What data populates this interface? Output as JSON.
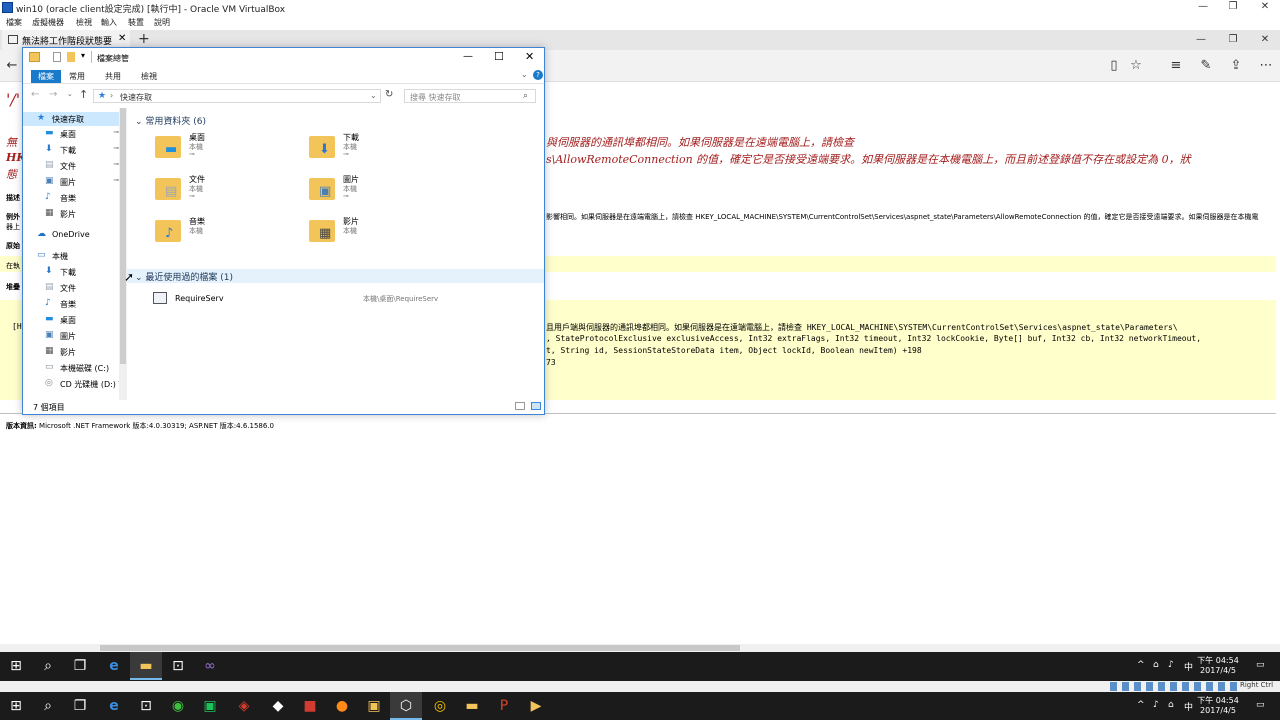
{
  "host": {
    "title": "win10 (oracle client設定完成) [執行中] - Oracle VM VirtualBox",
    "menu": [
      "檔案",
      "虛擬機器",
      "檢視",
      "輸入",
      "裝置",
      "說明"
    ],
    "status_right": "Right Ctrl"
  },
  "browser": {
    "tab_title": "無法將工作階段狀態要求",
    "new_tab": "+"
  },
  "page": {
    "title": "'/'",
    "err_line1_left": "無",
    "err_line1_right": "與伺服器的通訊埠都相同。如果伺服器是在遠端電腦上，請檢查",
    "err_line2_left": "HK",
    "err_line2_right": "s\\AllowRemoteConnection 的值，確定它是否接受遠端要求。如果伺服器是在本機電腦上，而且前述登錄值不存在或設定為 0，狀",
    "err_line3_left": "態",
    "label_desc": "描述",
    "label_exception": "例外",
    "exception_text": "影響相同。如果伺服器是在遠端電腦上，請檢查 HKEY_LOCAL_MACHINE\\SYSTEM\\CurrentControlSet\\Services\\aspnet_state\\Parameters\\AllowRemoteConnection 的值，確定它是否接受遠端要求。如果伺服器是在本機電",
    "exception_text2": "器上",
    "label_source": "原始",
    "source_note": "在執",
    "label_stack": "堆疊",
    "stack_line0": "[H",
    "stack_line1": "且用戶端與伺服器的通訊埠都相同。如果伺服器是在遠端電腦上，請檢查 HKEY_LOCAL_MACHINE\\SYSTEM\\CurrentControlSet\\Services\\aspnet_state\\Parameters\\",
    "stack_line2": ", StateProtocolExclusive exclusiveAccess, Int32 extraFlags, Int32 timeout, Int32 lockCookie, Byte[] buf, Int32 cb, Int32 networkTimeout,",
    "stack_line3": "t, String id, SessionStateStoreData item, Object lockId, Boolean newItem) +198",
    "stack_line4": "73",
    "version_label": "版本資訊:",
    "version_text": "Microsoft .NET Framework 版本:4.0.30319; ASP.NET 版本:4.6.1586.0"
  },
  "explorer": {
    "title": "檔案總管",
    "ribbon": {
      "file": "檔案",
      "tabs": [
        "常用",
        "共用",
        "檢視"
      ]
    },
    "address": "快速存取",
    "search_placeholder": "搜尋 快速存取",
    "tree": [
      {
        "label": "快速存取",
        "icon": "star-icon",
        "pinned": false,
        "color": "#2d7fd8"
      },
      {
        "label": "桌面",
        "icon": "desktop-icon",
        "pinned": true,
        "color": "#1f8fe0"
      },
      {
        "label": "下載",
        "icon": "download-icon",
        "pinned": true,
        "color": "#2b78d0"
      },
      {
        "label": "文件",
        "icon": "document-icon",
        "pinned": true,
        "color": "#9aa6b3"
      },
      {
        "label": "圖片",
        "icon": "picture-icon",
        "pinned": true,
        "color": "#4a7fb5"
      },
      {
        "label": "音樂",
        "icon": "music-icon",
        "pinned": false,
        "color": "#2b78d0"
      },
      {
        "label": "影片",
        "icon": "video-icon",
        "pinned": false,
        "color": "#555555"
      },
      {
        "label": "OneDrive",
        "icon": "cloud-icon",
        "pinned": false,
        "color": "#1e70c9"
      },
      {
        "label": "本機",
        "icon": "computer-icon",
        "pinned": false,
        "color": "#3b82c4"
      },
      {
        "label": "下載",
        "icon": "download-icon",
        "pinned": false,
        "color": "#2b78d0"
      },
      {
        "label": "文件",
        "icon": "document-icon",
        "pinned": false,
        "color": "#9aa6b3"
      },
      {
        "label": "音樂",
        "icon": "music-icon",
        "pinned": false,
        "color": "#2b78d0"
      },
      {
        "label": "桌面",
        "icon": "desktop-icon",
        "pinned": false,
        "color": "#1f8fe0"
      },
      {
        "label": "圖片",
        "icon": "picture-icon",
        "pinned": false,
        "color": "#4a7fb5"
      },
      {
        "label": "影片",
        "icon": "video-icon",
        "pinned": false,
        "color": "#555555"
      },
      {
        "label": "本機磁碟 (C:)",
        "icon": "drive-icon",
        "pinned": false,
        "color": "#7a8a99"
      },
      {
        "label": "CD 光碟機 (D:) V",
        "icon": "cd-icon",
        "pinned": false,
        "color": "#888888"
      }
    ],
    "frequent_header": "常用資料夾 (6)",
    "folders": [
      {
        "name": "桌面",
        "sub": "本機",
        "pinned": true,
        "icon": "desktop-folder-icon"
      },
      {
        "name": "下載",
        "sub": "本機",
        "pinned": true,
        "icon": "download-folder-icon"
      },
      {
        "name": "文件",
        "sub": "本機",
        "pinned": true,
        "icon": "document-folder-icon"
      },
      {
        "name": "圖片",
        "sub": "本機",
        "pinned": true,
        "icon": "picture-folder-icon"
      },
      {
        "name": "音樂",
        "sub": "本機",
        "pinned": false,
        "icon": "music-folder-icon"
      },
      {
        "name": "影片",
        "sub": "本機",
        "pinned": false,
        "icon": "video-folder-icon"
      }
    ],
    "recent_header": "最近使用過的檔案 (1)",
    "recent_files": [
      {
        "name": "RequireServ",
        "path": "本機\\桌面\\RequireServ"
      }
    ],
    "status": "7 個項目"
  },
  "taskbar": {
    "clock_time": "下午 04:54",
    "clock_date": "2017/4/5",
    "ime": "中",
    "tray_up": "^"
  }
}
